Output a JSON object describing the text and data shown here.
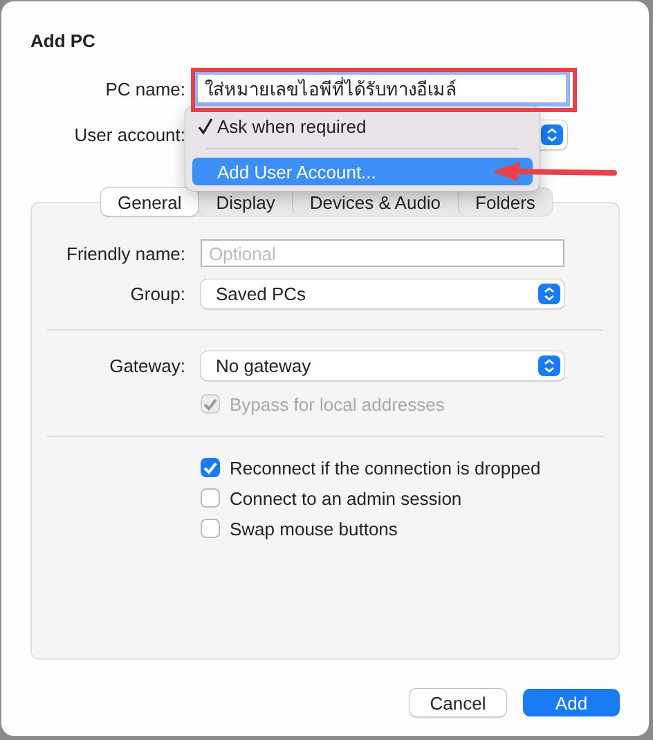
{
  "window": {
    "title": "Add PC"
  },
  "pc_name": {
    "label": "PC name:",
    "value": "ใส่หมายเลขไอพีที่ได้รับทางอีเมล์"
  },
  "user_account": {
    "label": "User account:",
    "menu": [
      {
        "label": "Ask when required",
        "checked": true,
        "selected": false
      },
      {
        "label": "Add User Account...",
        "checked": false,
        "selected": true
      }
    ]
  },
  "tabs": [
    {
      "label": "General",
      "selected": true
    },
    {
      "label": "Display",
      "selected": false
    },
    {
      "label": "Devices & Audio",
      "selected": false
    },
    {
      "label": "Folders",
      "selected": false
    }
  ],
  "friendly_name": {
    "label": "Friendly name:",
    "placeholder": "Optional"
  },
  "group": {
    "label": "Group:",
    "value": "Saved PCs"
  },
  "gateway": {
    "label": "Gateway:",
    "value": "No gateway"
  },
  "bypass": {
    "label": "Bypass for local addresses",
    "checked": true,
    "disabled": true
  },
  "options": [
    {
      "label": "Reconnect if the connection is dropped",
      "checked": true,
      "disabled": false
    },
    {
      "label": "Connect to an admin session",
      "checked": false,
      "disabled": false
    },
    {
      "label": "Swap mouse buttons",
      "checked": false,
      "disabled": false
    }
  ],
  "buttons": [
    {
      "label": "Cancel",
      "kind": "secondary"
    },
    {
      "label": "Add",
      "kind": "primary"
    }
  ]
}
